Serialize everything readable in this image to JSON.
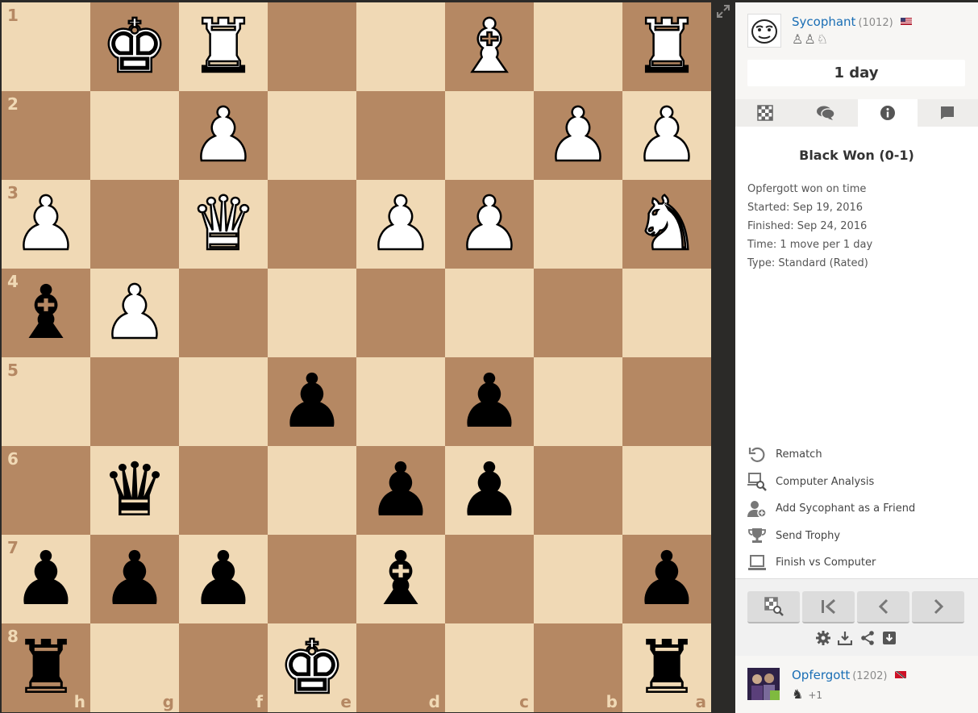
{
  "board": {
    "rank_labels": [
      "1",
      "2",
      "3",
      "4",
      "5",
      "6",
      "7",
      "8"
    ],
    "file_labels": [
      "h",
      "g",
      "f",
      "e",
      "d",
      "c",
      "b",
      "a"
    ],
    "colors": {
      "light": "#f0d9b5",
      "dark": "#b58863"
    },
    "pieces": [
      {
        "row": 0,
        "col": 1,
        "color": "w",
        "type": "k",
        "glyph": "♚"
      },
      {
        "row": 0,
        "col": 2,
        "color": "w",
        "type": "r",
        "glyph": "♜"
      },
      {
        "row": 0,
        "col": 5,
        "color": "w",
        "type": "b",
        "glyph": "♝"
      },
      {
        "row": 0,
        "col": 7,
        "color": "w",
        "type": "r",
        "glyph": "♜"
      },
      {
        "row": 1,
        "col": 2,
        "color": "w",
        "type": "p",
        "glyph": "♟"
      },
      {
        "row": 1,
        "col": 6,
        "color": "w",
        "type": "p",
        "glyph": "♟"
      },
      {
        "row": 1,
        "col": 7,
        "color": "w",
        "type": "p",
        "glyph": "♟"
      },
      {
        "row": 2,
        "col": 0,
        "color": "w",
        "type": "p",
        "glyph": "♟"
      },
      {
        "row": 2,
        "col": 2,
        "color": "w",
        "type": "q",
        "glyph": "♛"
      },
      {
        "row": 2,
        "col": 4,
        "color": "w",
        "type": "p",
        "glyph": "♟"
      },
      {
        "row": 2,
        "col": 5,
        "color": "w",
        "type": "p",
        "glyph": "♟"
      },
      {
        "row": 2,
        "col": 7,
        "color": "w",
        "type": "n",
        "glyph": "♞"
      },
      {
        "row": 3,
        "col": 0,
        "color": "b",
        "type": "b",
        "glyph": "♝"
      },
      {
        "row": 3,
        "col": 1,
        "color": "w",
        "type": "p",
        "glyph": "♟"
      },
      {
        "row": 4,
        "col": 3,
        "color": "b",
        "type": "p",
        "glyph": "♟"
      },
      {
        "row": 4,
        "col": 5,
        "color": "b",
        "type": "p",
        "glyph": "♟"
      },
      {
        "row": 5,
        "col": 1,
        "color": "b",
        "type": "q",
        "glyph": "♛"
      },
      {
        "row": 5,
        "col": 4,
        "color": "b",
        "type": "p",
        "glyph": "♟"
      },
      {
        "row": 5,
        "col": 5,
        "color": "b",
        "type": "p",
        "glyph": "♟"
      },
      {
        "row": 6,
        "col": 0,
        "color": "b",
        "type": "p",
        "glyph": "♟"
      },
      {
        "row": 6,
        "col": 1,
        "color": "b",
        "type": "p",
        "glyph": "♟"
      },
      {
        "row": 6,
        "col": 2,
        "color": "b",
        "type": "p",
        "glyph": "♟"
      },
      {
        "row": 6,
        "col": 4,
        "color": "b",
        "type": "b",
        "glyph": "♝"
      },
      {
        "row": 6,
        "col": 7,
        "color": "b",
        "type": "p",
        "glyph": "♟"
      },
      {
        "row": 7,
        "col": 0,
        "color": "b",
        "type": "r",
        "glyph": "♜"
      },
      {
        "row": 7,
        "col": 3,
        "color": "w",
        "type": "k",
        "glyph": "♚"
      },
      {
        "row": 7,
        "col": 7,
        "color": "b",
        "type": "r",
        "glyph": "♜"
      }
    ]
  },
  "top_player": {
    "name": "Sycophant",
    "rating": "(1012)",
    "captured": "♙♙♘",
    "flag_icon": "us-flag-icon"
  },
  "clock": {
    "value": "1 day"
  },
  "tabs": [
    {
      "icon": "board-icon"
    },
    {
      "icon": "chat-icon"
    },
    {
      "icon": "info-icon",
      "active": true
    },
    {
      "icon": "book-icon"
    }
  ],
  "game_info": {
    "result": "Black Won (0-1)",
    "lines": [
      "Opfergott won on time",
      "Started: Sep 19, 2016",
      "Finished: Sep 24, 2016",
      "Time: 1 move per 1 day",
      "Type: Standard (Rated)"
    ]
  },
  "actions": [
    {
      "label": "Rematch",
      "icon": "rematch-icon"
    },
    {
      "label": "Computer Analysis",
      "icon": "analysis-icon"
    },
    {
      "label": "Add Sycophant as a Friend",
      "icon": "add-friend-icon"
    },
    {
      "label": "Send Trophy",
      "icon": "trophy-icon"
    },
    {
      "label": "Finish vs Computer",
      "icon": "computer-icon"
    }
  ],
  "bottom_player": {
    "name": "Opfergott",
    "rating": "(1202)",
    "captured": "♞",
    "extra": "+1",
    "flag_icon": "tt-flag-icon"
  }
}
